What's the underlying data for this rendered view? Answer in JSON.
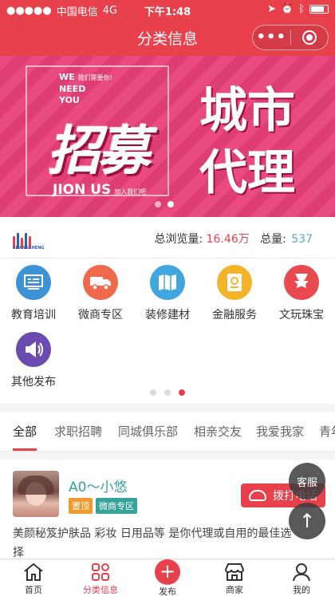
{
  "status_bar": {
    "carrier": "中国电信",
    "network": "4G",
    "time": "下午1:48"
  },
  "nav": {
    "title": "分类信息",
    "more_label": "•••"
  },
  "banner": {
    "we_line1": "WE",
    "we_line1_cn": "我们需要你!",
    "we_line2": "NEED",
    "we_line3": "YOU",
    "headline": "招募",
    "join": "JION US",
    "join_cn": "加入我们吧",
    "city_line1": "城市",
    "city_line2": "代理",
    "dots": 2,
    "active_dot": 1
  },
  "stats": {
    "logo_text": "CHANGSHENG",
    "views_label": "总浏览量:",
    "views_value": "16.46万",
    "total_label": "总量:",
    "total_value": "537"
  },
  "categories": [
    {
      "label": "教育培训",
      "icon": "classroom-icon",
      "color": "#3d93d6",
      "glyph": "▦"
    },
    {
      "label": "微商专区",
      "icon": "truck-icon",
      "color": "#ef6a4d",
      "glyph": "⛟"
    },
    {
      "label": "装修建材",
      "icon": "map-icon",
      "color": "#3fa7dd",
      "glyph": "▤"
    },
    {
      "label": "金融服务",
      "icon": "passport-icon",
      "color": "#f4b329",
      "glyph": "▣"
    },
    {
      "label": "文玩珠宝",
      "icon": "medal-icon",
      "color": "#e84a4f",
      "glyph": "★"
    },
    {
      "label": "其他发布",
      "icon": "speaker-icon",
      "color": "#6b4bb0",
      "glyph": "◀"
    }
  ],
  "category_pager": {
    "dots": 3,
    "active": 2
  },
  "tabs": [
    "全部",
    "求职招聘",
    "同城俱乐部",
    "相亲交友",
    "我爱我家",
    "青年"
  ],
  "listing": {
    "name": "A0～小悠",
    "tag_top": "置顶",
    "tag_cat": "微商专区",
    "tag_top_color": "#f39a2c",
    "tag_cat_color": "#36a39a",
    "call_label": "拨打电话",
    "desc": "美颜秘笈护肤品 彩妆 日用品等 是你代理或自用的最佳选",
    "desc2": "择"
  },
  "floating": {
    "kefu": "客服",
    "top": "↑"
  },
  "tabbar": [
    {
      "label": "首页",
      "icon": "home-icon"
    },
    {
      "label": "分类信息",
      "icon": "category-icon"
    },
    {
      "label": "发布",
      "icon": "publish-icon"
    },
    {
      "label": "商家",
      "icon": "shop-icon"
    },
    {
      "label": "我的",
      "icon": "profile-icon"
    }
  ],
  "colors": {
    "primary": "#e8414c",
    "banner_pink": "#e8417a",
    "accent_teal": "#36a39a"
  }
}
